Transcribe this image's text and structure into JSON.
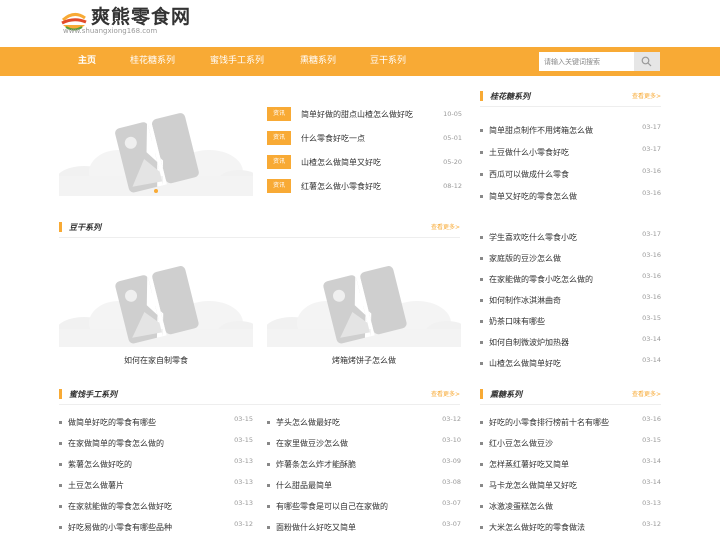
{
  "site": {
    "name": "爽熊零食网",
    "url": "www.shuangxiong168.com"
  },
  "nav": {
    "items": [
      "主页",
      "桂花糖系列",
      "蜜饯手工系列",
      "熏糖系列",
      "豆干系列"
    ]
  },
  "search": {
    "placeholder": "请输入关键词搜索"
  },
  "featured": {
    "tag": "资讯",
    "items": [
      {
        "title": "简单好做的甜点山楂怎么做好吃",
        "date": "10-05"
      },
      {
        "title": "什么零食好吃一点",
        "date": "05-01"
      },
      {
        "title": "山楂怎么做简单又好吃",
        "date": "05-20"
      },
      {
        "title": "红薯怎么做小零食好吃",
        "date": "08-12"
      }
    ]
  },
  "guihua": {
    "title": "桂花糖系列",
    "more": "查看更多>",
    "items": [
      {
        "title": "简单甜点制作不用烤箱怎么做",
        "date": "03-17"
      },
      {
        "title": "土豆做什么小零食好吃",
        "date": "03-17"
      },
      {
        "title": "西瓜可以做成什么零食",
        "date": "03-16"
      },
      {
        "title": "简单又好吃的零食怎么做",
        "date": "03-16"
      }
    ]
  },
  "dougan": {
    "title": "豆干系列",
    "more": "查看更多>",
    "cards": [
      {
        "caption": "如何在家自制零食"
      },
      {
        "caption": "烤箱烤饼子怎么做"
      }
    ],
    "items": [
      {
        "title": "学生喜欢吃什么零食小吃",
        "date": "03-17"
      },
      {
        "title": "家庭版的豆沙怎么做",
        "date": "03-16"
      },
      {
        "title": "在家能做的零食小吃怎么做的",
        "date": "03-16"
      },
      {
        "title": "如何制作冰淇淋曲奇",
        "date": "03-16"
      },
      {
        "title": "奶茶口味有哪些",
        "date": "03-15"
      },
      {
        "title": "如何自制微波炉加热器",
        "date": "03-14"
      },
      {
        "title": "山楂怎么做简单好吃",
        "date": "03-14"
      }
    ]
  },
  "mijian": {
    "title": "蜜饯手工系列",
    "more": "查看更多>",
    "left": [
      {
        "title": "做简单好吃的零食有哪些",
        "date": "03-15"
      },
      {
        "title": "在家做简单的零食怎么做的",
        "date": "03-15"
      },
      {
        "title": "紫薯怎么做好吃的",
        "date": "03-13"
      },
      {
        "title": "土豆怎么做薯片",
        "date": "03-13"
      },
      {
        "title": "在家就能做的零食怎么做好吃",
        "date": "03-13"
      },
      {
        "title": "好吃易做的小零食有哪些品种",
        "date": "03-12"
      }
    ],
    "right": [
      {
        "title": "芋头怎么做最好吃",
        "date": "03-12"
      },
      {
        "title": "在家里做豆沙怎么做",
        "date": "03-10"
      },
      {
        "title": "炸薯条怎么炸才能酥脆",
        "date": "03-09"
      },
      {
        "title": "什么甜品最简单",
        "date": "03-08"
      },
      {
        "title": "有哪些零食是可以自己在家做的",
        "date": "03-07"
      },
      {
        "title": "面粉做什么好吃又简单",
        "date": "03-07"
      }
    ]
  },
  "xuntang": {
    "title": "熏糖系列",
    "more": "查看更多>",
    "items": [
      {
        "title": "好吃的小零食排行榜前十名有哪些",
        "date": "03-16"
      },
      {
        "title": "红小豆怎么做豆沙",
        "date": "03-15"
      },
      {
        "title": "怎样蒸红薯好吃又简单",
        "date": "03-14"
      },
      {
        "title": "马卡龙怎么做简单又好吃",
        "date": "03-14"
      },
      {
        "title": "冰激凌蛋糕怎么做",
        "date": "03-13"
      },
      {
        "title": "大米怎么做好吃的零食做法",
        "date": "03-12"
      }
    ]
  },
  "colors": {
    "accent": "#F8AA35"
  }
}
